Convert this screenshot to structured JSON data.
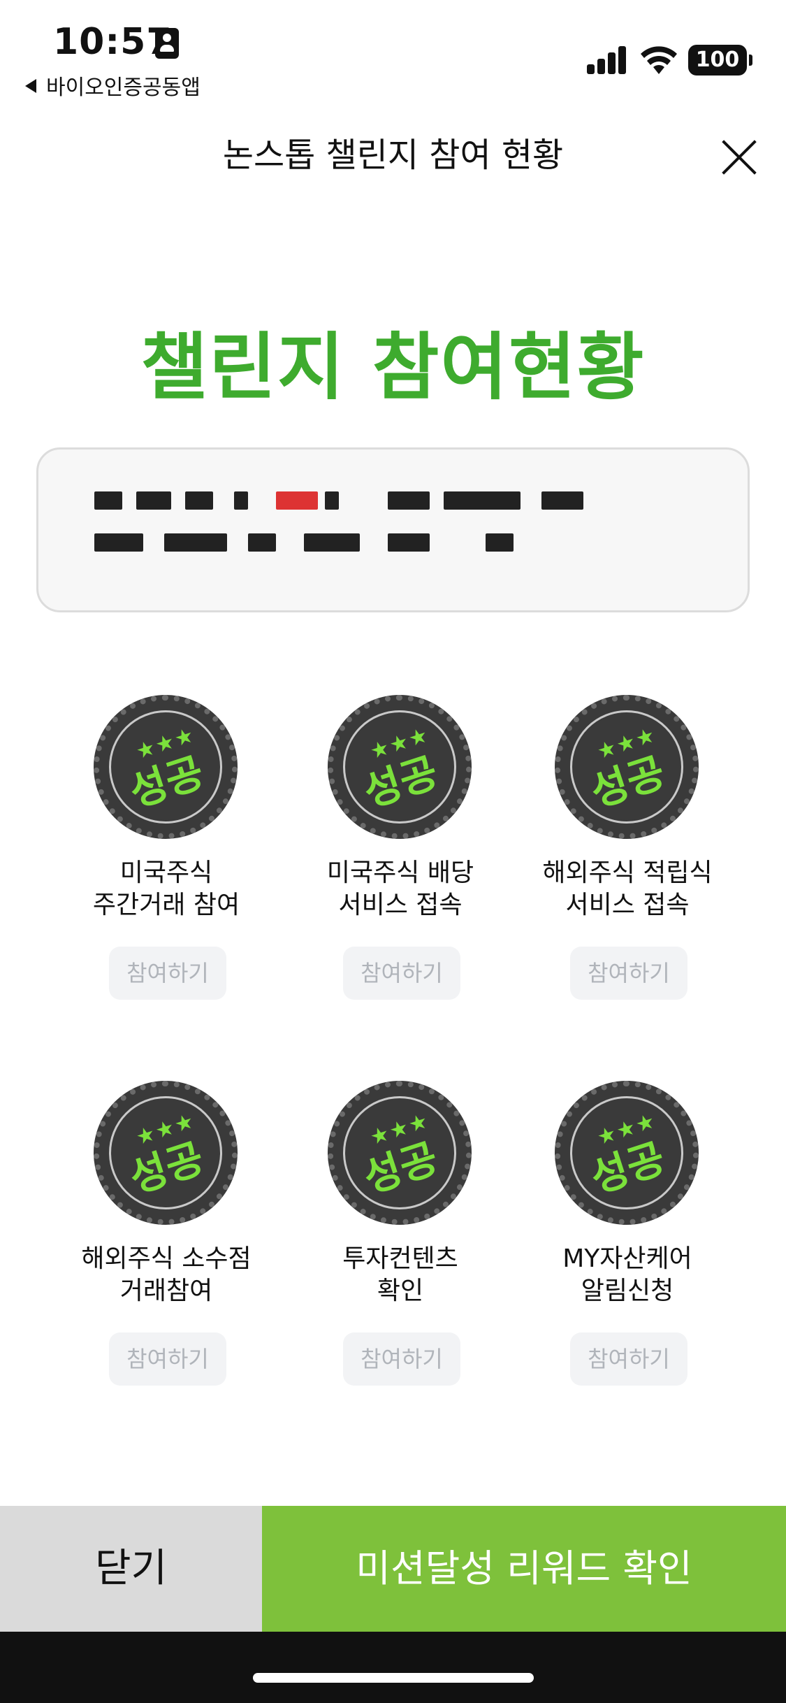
{
  "status": {
    "time": "10:57",
    "back_app": "바이오인증공동앱",
    "battery": "100"
  },
  "header": {
    "title": "논스톱 챌린지 참여 현황"
  },
  "main": {
    "title": "챌린지 참여현황"
  },
  "challenges": [
    {
      "label": "미국주식\n주간거래 참여",
      "badge": "성공",
      "button": "참여하기"
    },
    {
      "label": "미국주식 배당\n서비스 접속",
      "badge": "성공",
      "button": "참여하기"
    },
    {
      "label": "해외주식 적립식\n서비스 접속",
      "badge": "성공",
      "button": "참여하기"
    },
    {
      "label": "해외주식 소수점\n거래참여",
      "badge": "성공",
      "button": "참여하기"
    },
    {
      "label": "투자컨텐츠\n확인",
      "badge": "성공",
      "button": "참여하기"
    },
    {
      "label": "MY자산케어\n알림신청",
      "badge": "성공",
      "button": "참여하기"
    }
  ],
  "footer": {
    "close_label": "닫기",
    "reward_label": "미션달성 리워드 확인"
  },
  "colors": {
    "brand_green": "#3eab2e",
    "reward_button": "#7ec13b",
    "badge_text": "#7be13b"
  }
}
